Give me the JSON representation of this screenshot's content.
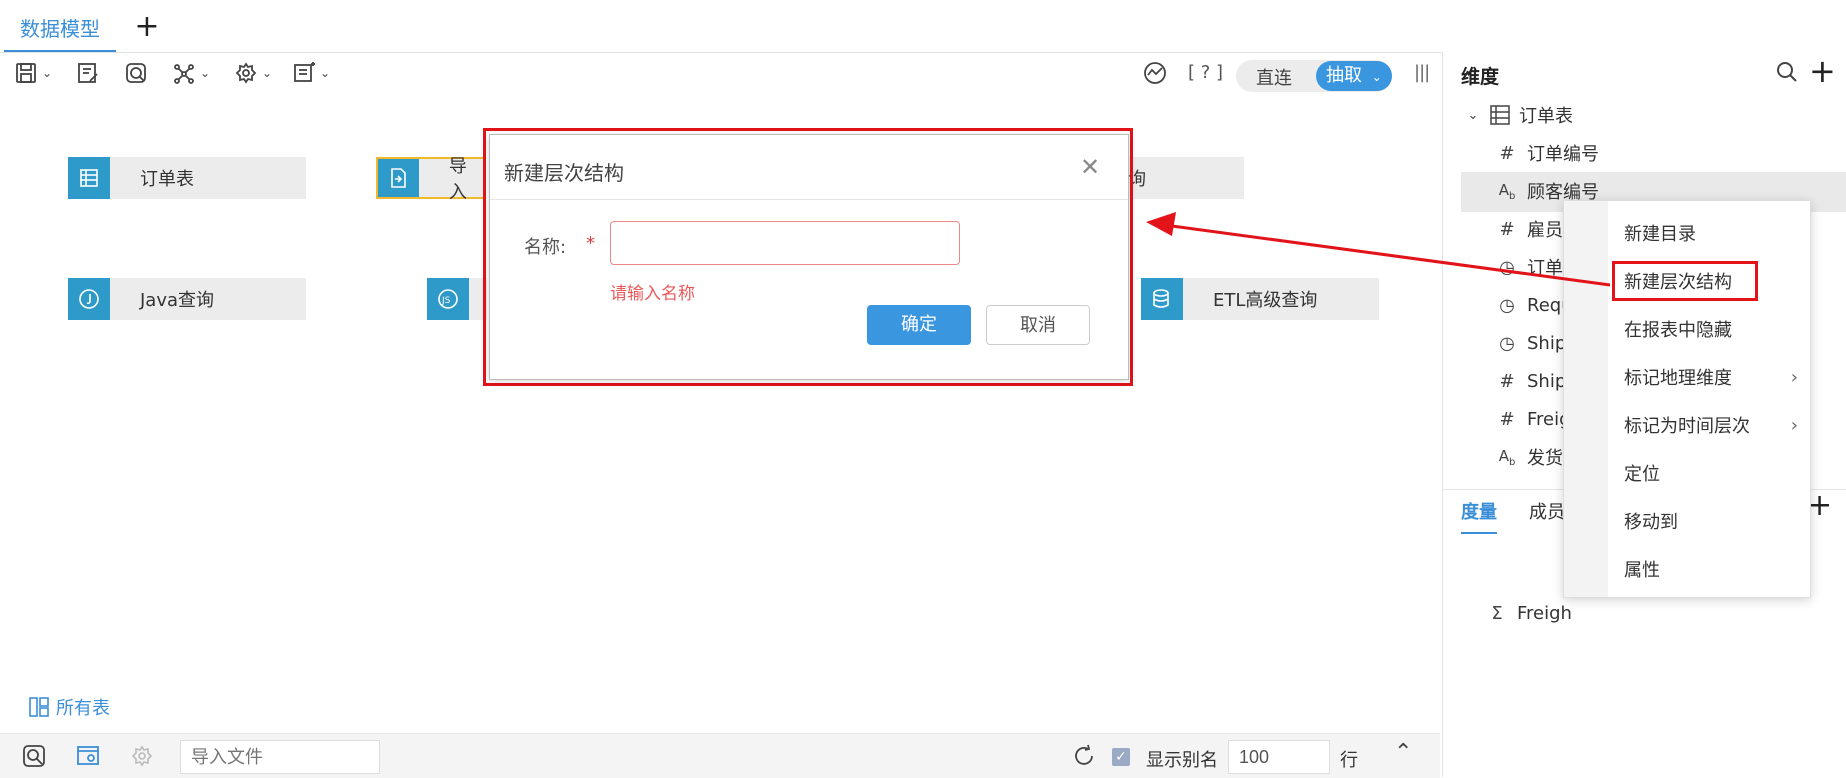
{
  "tabs": {
    "active": "数据模型",
    "add_symbol": "+"
  },
  "toolbar": {
    "help": "[ ? ]",
    "mode_direct": "直连",
    "mode_extract": "抽取"
  },
  "canvas": {
    "tables": [
      "订单表",
      "导入",
      "询",
      "Java查询",
      "ETL高级查询"
    ],
    "all_tables": "所有表"
  },
  "dialog": {
    "title": "新建层次结构",
    "name_label": "名称:",
    "required_mark": "*",
    "name_value": "",
    "error": "请输入名称",
    "ok": "确定",
    "cancel": "取消"
  },
  "panel": {
    "dimension_title": "维度",
    "tree_root": "订单表",
    "fields": [
      {
        "icon": "#",
        "label": "订单编号"
      },
      {
        "icon": "Ab",
        "label": "顾客编号"
      },
      {
        "icon": "#",
        "label": "雇员"
      },
      {
        "icon": "cal",
        "label": "订单"
      },
      {
        "icon": "cal",
        "label": "Requ"
      },
      {
        "icon": "cal",
        "label": "Ship"
      },
      {
        "icon": "#",
        "label": "Ship"
      },
      {
        "icon": "#",
        "label": "Freig"
      },
      {
        "icon": "Ab",
        "label": "发货"
      }
    ],
    "measure_tab": "度量",
    "member_tab": "成员",
    "measure_item": "Freigh"
  },
  "context_menu": {
    "items": [
      "新建目录",
      "新建层次结构",
      "在报表中隐藏",
      "标记地理维度",
      "标记为时间层次",
      "定位",
      "移动到",
      "属性"
    ]
  },
  "bottom": {
    "import_file": "导入文件",
    "show_alias": "显示别名",
    "rows": "100",
    "rows_unit": "行"
  },
  "colors": {
    "accent": "#3b96e0",
    "table_icon": "#2e9ac9",
    "highlight": "#e3131a",
    "error": "#e85a5a"
  }
}
